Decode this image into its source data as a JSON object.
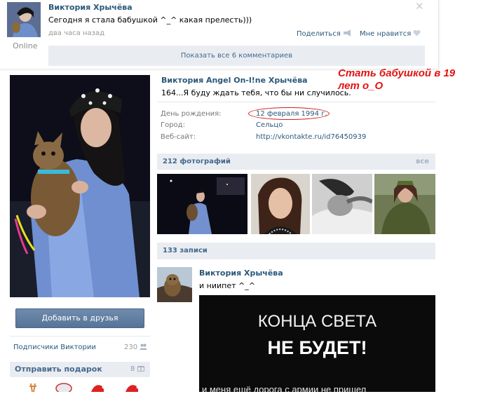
{
  "top_post": {
    "author": "Виктория Хрычёва",
    "text": "Сегодня я стала бабушкой ^_^ какая прелесть)))",
    "time": "два часа назад",
    "online": "Online",
    "share": "Поделиться",
    "dislike": "Мне нравится",
    "show_comments": "Показать все 6 комментариев",
    "close": "✕"
  },
  "profile": {
    "name": "Виктория Angel On-l!ne Хрычёва",
    "status": "164...Я буду ждать тебя, что бы ни случилось.",
    "info": [
      {
        "label": "День рождения:",
        "value": "12 февраля 1994 г."
      },
      {
        "label": "Город:",
        "value": "Сельцо"
      },
      {
        "label": "Веб-сайт:",
        "value": "http://vkontakte.ru/id76450939"
      }
    ],
    "add_friend": "Добавить в друзья",
    "subscribers": {
      "label": "Подписчики Виктории",
      "count": "230"
    },
    "gift": {
      "label": "Отправить подарок",
      "count": "8"
    }
  },
  "photos": {
    "header": "212 фотографий",
    "all": "все"
  },
  "wall": {
    "header": "133 записи",
    "author": "Виктория Хрычёва",
    "text": "и ниипет ^_^",
    "image_line1": "КОНЦА СВЕТА",
    "image_line2": "НЕ БУДЕТ!",
    "image_line3": "и меня ещё дорога с армии не пришел"
  },
  "annotation": {
    "line1": "Стать бабушкой в 19",
    "line2": "лет о_О"
  },
  "colors": {
    "link": "#2b587a",
    "header_bg": "#e9edf1",
    "annotation": "#e21414",
    "button": "#5e7ea3"
  }
}
